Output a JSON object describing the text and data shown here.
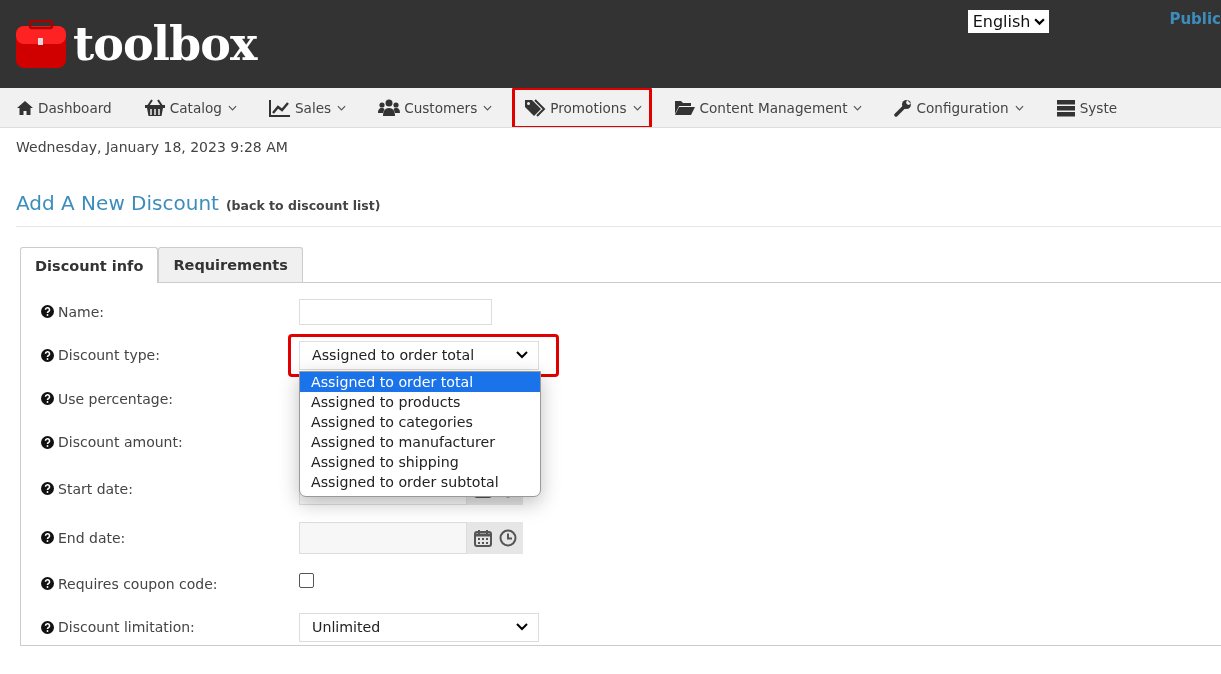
{
  "header": {
    "logo_text": "toolbox",
    "language": "English",
    "link": "Public"
  },
  "nav": {
    "items": [
      {
        "label": "Dashboard",
        "dropdown": false,
        "highlighted": false
      },
      {
        "label": "Catalog",
        "dropdown": true,
        "highlighted": false
      },
      {
        "label": "Sales",
        "dropdown": true,
        "highlighted": false
      },
      {
        "label": "Customers",
        "dropdown": true,
        "highlighted": false
      },
      {
        "label": "Promotions",
        "dropdown": true,
        "highlighted": true
      },
      {
        "label": "Content Management",
        "dropdown": true,
        "highlighted": false
      },
      {
        "label": "Configuration",
        "dropdown": true,
        "highlighted": false
      },
      {
        "label": "Syste",
        "dropdown": false,
        "highlighted": false
      }
    ]
  },
  "datetime": "Wednesday, January 18, 2023 9:28 AM",
  "page_title": "Add A New Discount",
  "back_link": "(back to discount list)",
  "tabs": [
    {
      "label": "Discount info",
      "selected": true
    },
    {
      "label": "Requirements",
      "selected": false
    }
  ],
  "fields": [
    {
      "label": "Name:",
      "kind": "text"
    },
    {
      "label": "Discount type:",
      "kind": "select",
      "value": "Assigned to order total",
      "highlighted": true,
      "options": [
        {
          "label": "Assigned to order total",
          "selected": true
        },
        {
          "label": "Assigned to products",
          "selected": false
        },
        {
          "label": "Assigned to categories",
          "selected": false
        },
        {
          "label": "Assigned to manufacturer",
          "selected": false
        },
        {
          "label": "Assigned to shipping",
          "selected": false
        },
        {
          "label": "Assigned to order subtotal",
          "selected": false
        }
      ]
    },
    {
      "label": "Use percentage:",
      "kind": "covered"
    },
    {
      "label": "Discount amount:",
      "kind": "covered"
    },
    {
      "label": "Start date:",
      "kind": "date"
    },
    {
      "label": "End date:",
      "kind": "date"
    },
    {
      "label": "Requires coupon code:",
      "kind": "checkbox",
      "checked": false
    },
    {
      "label": "Discount limitation:",
      "kind": "select",
      "value": "Unlimited",
      "highlighted": false
    }
  ]
}
